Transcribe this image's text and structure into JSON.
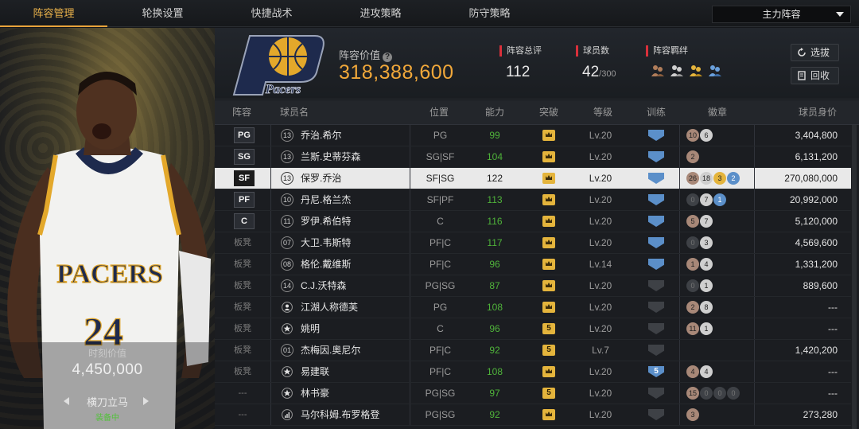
{
  "nav": {
    "tabs": [
      {
        "label": "阵容管理",
        "active": true
      },
      {
        "label": "轮换设置",
        "active": false
      },
      {
        "label": "快捷战术",
        "active": false
      },
      {
        "label": "进攻策略",
        "active": false
      },
      {
        "label": "防守策略",
        "active": false
      }
    ],
    "lineup_select": "主力阵容"
  },
  "player_panel": {
    "jersey_team": "PACERS",
    "jersey_number": "24",
    "value_label": "时刻价值",
    "value": "4,450,000",
    "skill_name": "横刀立马",
    "skill_status": "装备中"
  },
  "header": {
    "logo_text": "Pacers",
    "lineup_value_label": "阵容价值",
    "lineup_value": "318,388,600",
    "rating_label": "阵容总评",
    "rating": "112",
    "players_label": "球员数",
    "players_count": "42",
    "players_max": "/300",
    "bond_label": "阵容羁绊",
    "scout_button": "选拔",
    "recall_button": "回收"
  },
  "colors": {
    "accent": "#f1a83a",
    "positive": "#4fb33a",
    "badge_red": "#d9303b",
    "train_blue": "#5b8fc9"
  },
  "table": {
    "headers": {
      "lineup": "阵容",
      "name": "球员名",
      "position": "位置",
      "ability": "能力",
      "breakthrough": "突破",
      "level": "等级",
      "training": "训练",
      "badges": "徽章",
      "price": "球员身价"
    },
    "rows": [
      {
        "slot": "PG",
        "starter": true,
        "num": "13",
        "name": "乔治.希尔",
        "pos": "PG",
        "ability": "99",
        "brk": "",
        "level": "Lv.20",
        "train": "blue",
        "train_num": "",
        "badges": [
          [
            "10",
            "#a88878"
          ],
          [
            "6",
            "#cfcfcf"
          ]
        ],
        "price": "3,404,800"
      },
      {
        "slot": "SG",
        "starter": true,
        "num": "13",
        "name": "兰斯.史蒂芬森",
        "pos": "SG|SF",
        "ability": "104",
        "brk": "",
        "level": "Lv.20",
        "train": "blue",
        "train_num": "",
        "badges": [
          [
            "2",
            "#a88878"
          ]
        ],
        "price": "6,131,200"
      },
      {
        "slot": "SF",
        "starter": true,
        "num": "13",
        "name": "保罗.乔治",
        "pos": "SF|SG",
        "ability": "122",
        "brk": "",
        "level": "Lv.20",
        "train": "blue",
        "train_num": "",
        "badges": [
          [
            "26",
            "#a88878"
          ],
          [
            "18",
            "#cfcfcf"
          ],
          [
            "3",
            "#e4b43c"
          ],
          [
            "2",
            "#5b8fc9"
          ]
        ],
        "price": "270,080,000",
        "selected": true
      },
      {
        "slot": "PF",
        "starter": true,
        "num": "10",
        "name": "丹尼.格兰杰",
        "pos": "SF|PF",
        "ability": "113",
        "brk": "",
        "level": "Lv.20",
        "train": "blue",
        "train_num": "",
        "badges": [
          [
            "0",
            "#3e4146"
          ],
          [
            "7",
            "#cfcfcf"
          ],
          [
            "1",
            "#5b8fc9"
          ]
        ],
        "price": "20,992,000"
      },
      {
        "slot": "C",
        "starter": true,
        "num": "11",
        "name": "罗伊.希伯特",
        "pos": "C",
        "ability": "116",
        "brk": "",
        "level": "Lv.20",
        "train": "blue",
        "train_num": "",
        "badges": [
          [
            "5",
            "#a88878"
          ],
          [
            "7",
            "#cfcfcf"
          ]
        ],
        "price": "5,120,000"
      },
      {
        "slot": "板凳",
        "starter": false,
        "num": "07",
        "name": "大卫.韦斯特",
        "pos": "PF|C",
        "ability": "117",
        "brk": "",
        "level": "Lv.20",
        "train": "blue",
        "train_num": "",
        "badges": [
          [
            "0",
            "#3e4146"
          ],
          [
            "3",
            "#cfcfcf"
          ]
        ],
        "price": "4,569,600"
      },
      {
        "slot": "板凳",
        "starter": false,
        "num": "08",
        "name": "格伦.戴维斯",
        "pos": "PF|C",
        "ability": "96",
        "brk": "",
        "level": "Lv.14",
        "train": "blue",
        "train_num": "",
        "badges": [
          [
            "1",
            "#a88878"
          ],
          [
            "4",
            "#cfcfcf"
          ]
        ],
        "price": "1,331,200"
      },
      {
        "slot": "板凳",
        "starter": false,
        "num": "14",
        "name": "C.J.沃特森",
        "pos": "PG|SG",
        "ability": "87",
        "brk": "",
        "level": "Lv.20",
        "train": "gray",
        "train_num": "",
        "badges": [
          [
            "0",
            "#3e4146"
          ],
          [
            "1",
            "#cfcfcf"
          ]
        ],
        "price": "889,600"
      },
      {
        "slot": "板凳",
        "starter": false,
        "num": "person",
        "name": "江湖人称德芙",
        "pos": "PG",
        "ability": "108",
        "brk": "",
        "level": "Lv.20",
        "train": "gray",
        "train_num": "",
        "badges": [
          [
            "2",
            "#a88878"
          ],
          [
            "8",
            "#cfcfcf"
          ]
        ],
        "price": "---"
      },
      {
        "slot": "板凳",
        "starter": false,
        "num": "star",
        "name": "姚明",
        "pos": "C",
        "ability": "96",
        "brk": "5",
        "level": "Lv.20",
        "train": "gray",
        "train_num": "",
        "badges": [
          [
            "11",
            "#a88878"
          ],
          [
            "1",
            "#cfcfcf"
          ]
        ],
        "price": "---"
      },
      {
        "slot": "板凳",
        "starter": false,
        "num": "01",
        "name": "杰梅因.奥尼尔",
        "pos": "PF|C",
        "ability": "92",
        "brk": "5",
        "level": "Lv.7",
        "train": "gray",
        "train_num": "",
        "badges": [],
        "price": "1,420,200"
      },
      {
        "slot": "板凳",
        "starter": false,
        "num": "star",
        "name": "易建联",
        "pos": "PF|C",
        "ability": "108",
        "brk": "",
        "level": "Lv.20",
        "train": "blue",
        "train_num": "5",
        "badges": [
          [
            "4",
            "#a88878"
          ],
          [
            "4",
            "#cfcfcf"
          ]
        ],
        "price": "---"
      },
      {
        "slot": "---",
        "starter": false,
        "num": "star",
        "name": "林书豪",
        "pos": "PG|SG",
        "ability": "97",
        "brk": "5",
        "level": "Lv.20",
        "train": "gray",
        "train_num": "",
        "badges": [
          [
            "15",
            "#a88878"
          ],
          [
            "0",
            "#3e4146"
          ],
          [
            "0",
            "#3e4146"
          ],
          [
            "0",
            "#3e4146"
          ]
        ],
        "price": "---"
      },
      {
        "slot": "---",
        "starter": false,
        "num": "bars",
        "name": "马尔科姆.布罗格登",
        "pos": "PG|SG",
        "ability": "92",
        "brk": "",
        "level": "Lv.20",
        "train": "gray",
        "train_num": "",
        "badges": [
          [
            "3",
            "#a88878"
          ]
        ],
        "price": "273,280"
      }
    ]
  }
}
